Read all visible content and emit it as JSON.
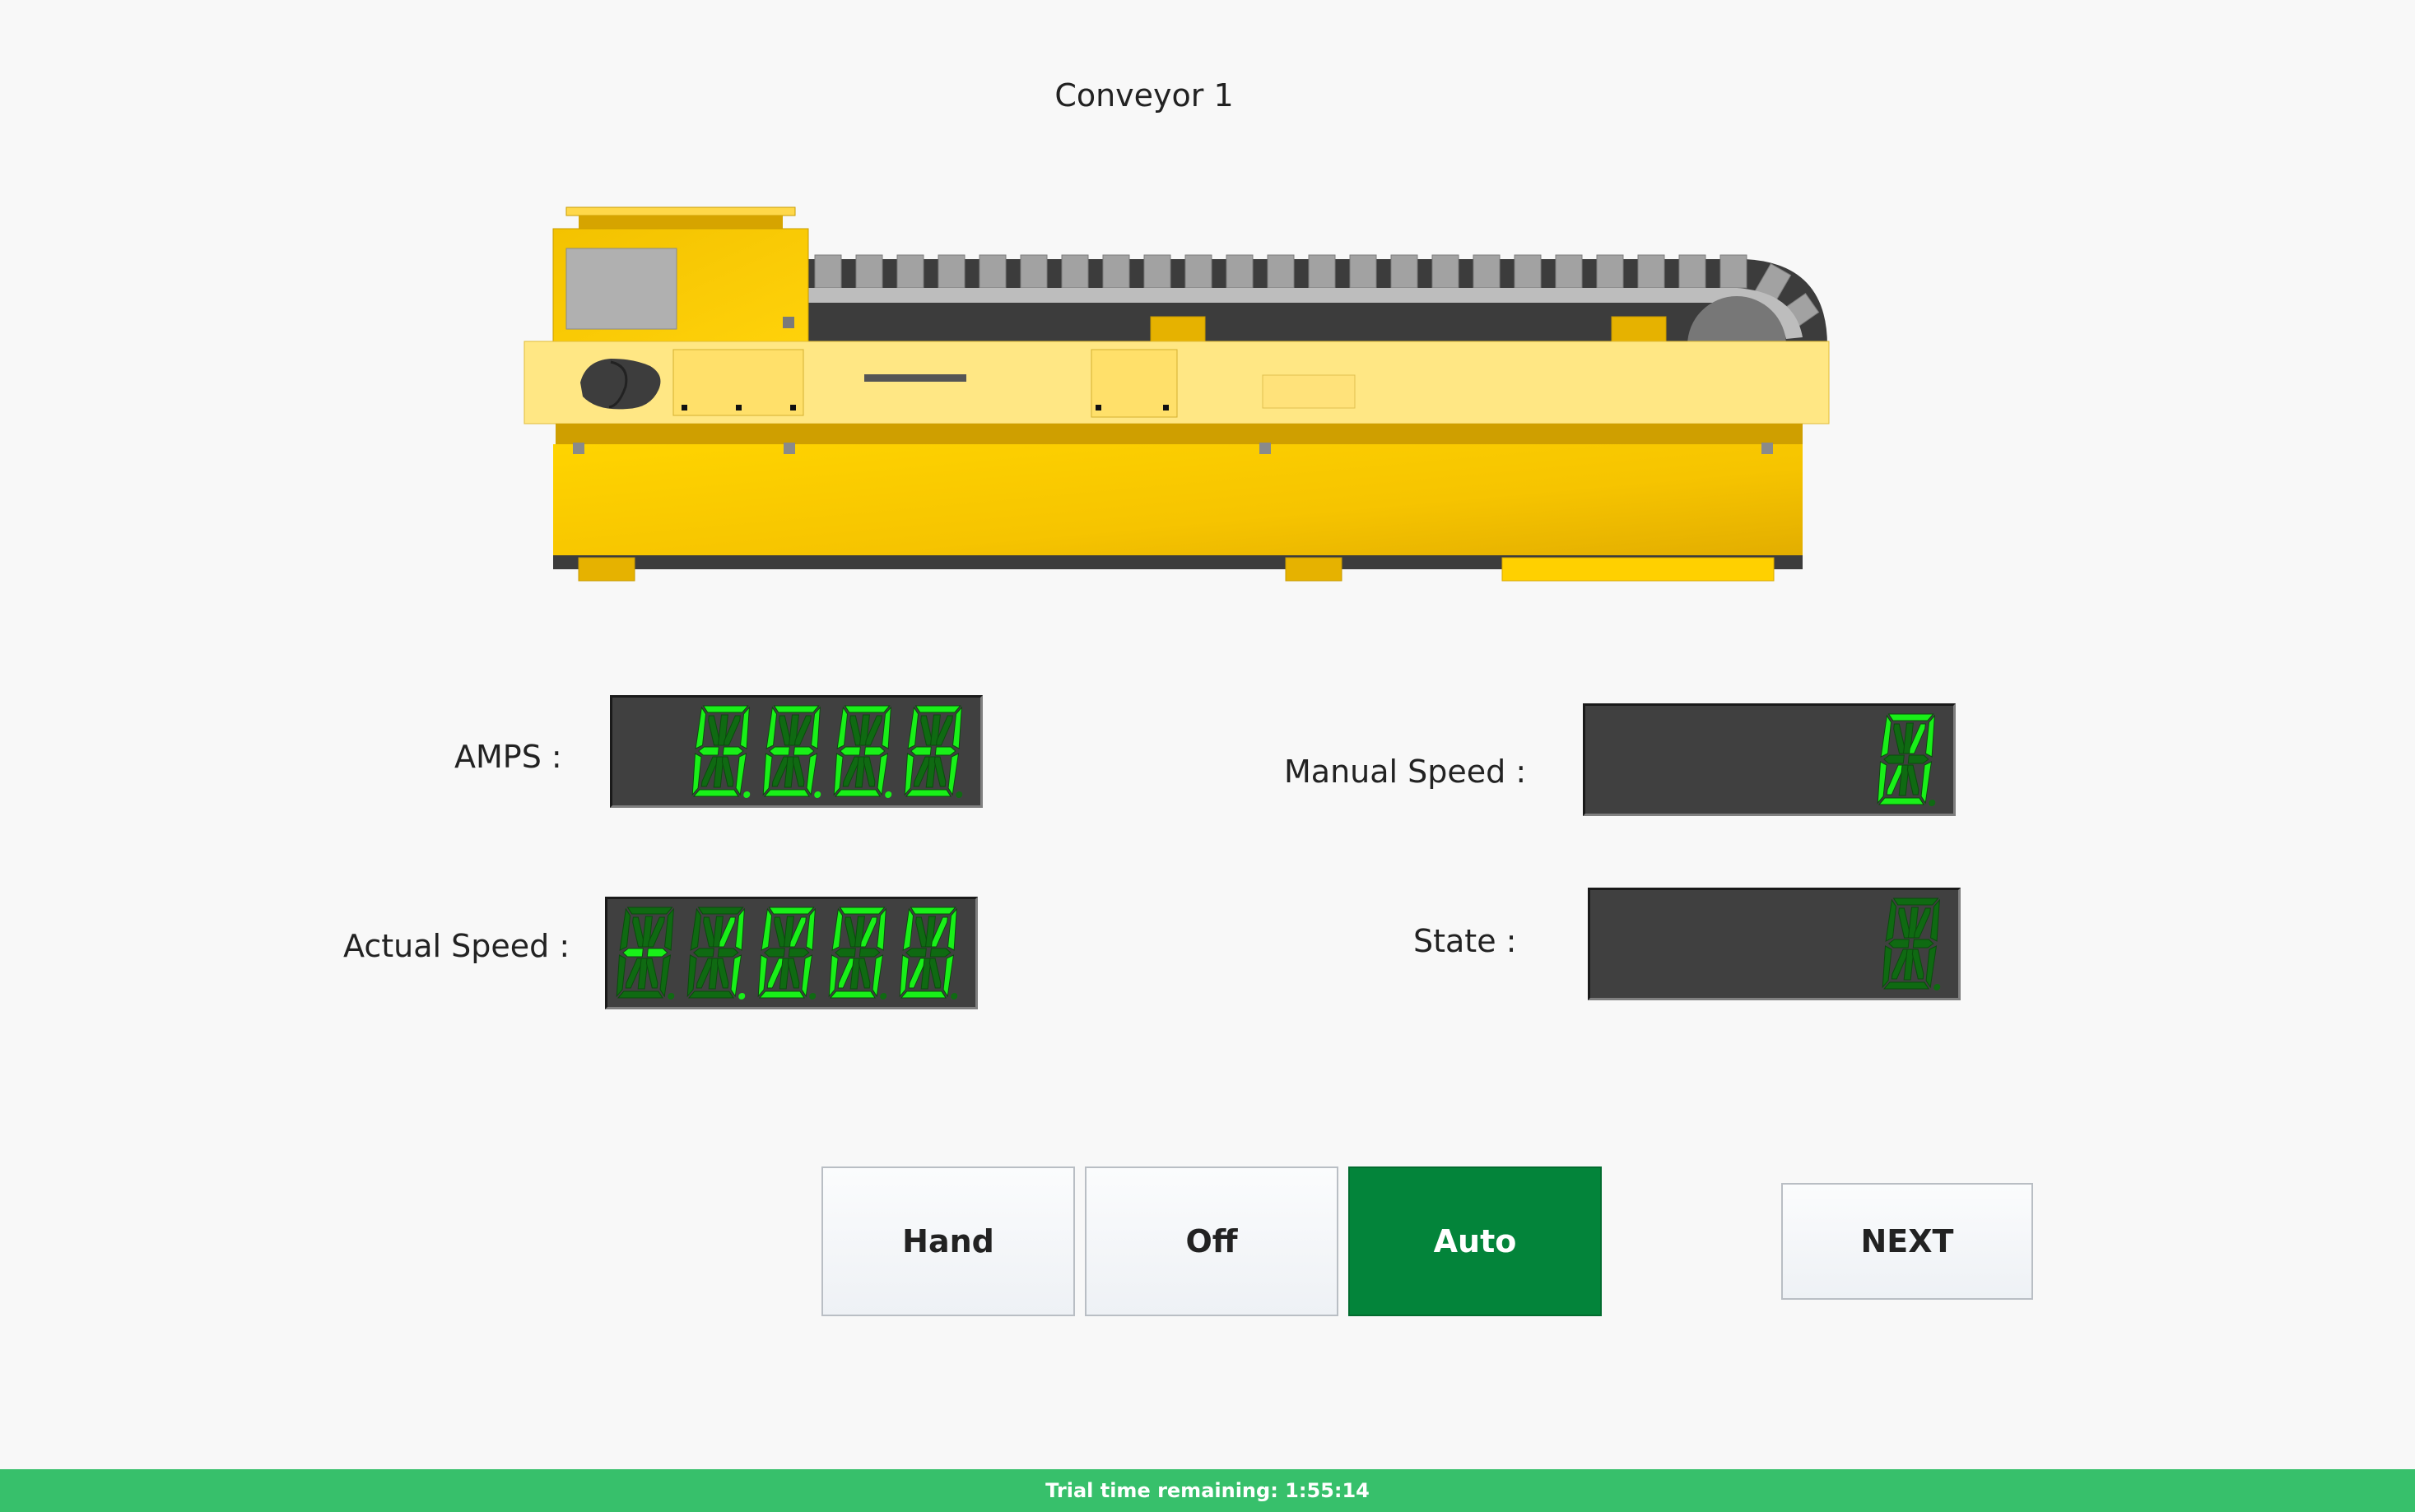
{
  "page": {
    "title": "Conveyor 1"
  },
  "readouts": {
    "amps": {
      "label": "AMPS :",
      "value": "8.8.8.8"
    },
    "actual_speed": {
      "label": "Actual Speed :",
      "value": "-1.000"
    },
    "manual_speed": {
      "label": "Manual Speed :",
      "value": "0"
    },
    "state": {
      "label": "State :",
      "value": ""
    }
  },
  "mode_buttons": [
    {
      "label": "Hand",
      "active": false
    },
    {
      "label": "Off",
      "active": false
    },
    {
      "label": "Auto",
      "active": true
    }
  ],
  "next_button": {
    "label": "NEXT"
  },
  "footer": {
    "trial_text": "Trial time remaining: 1:55:14"
  },
  "colors": {
    "accent_active": "#03843a",
    "footer_bg": "#37c06b",
    "segment_on": "#19f019",
    "segment_off": "#0f6a12",
    "display_bg": "#404040",
    "machine_yellow": "#ffd000"
  },
  "icons": {
    "conveyor_illustration": "conveyor-machine-icon"
  }
}
